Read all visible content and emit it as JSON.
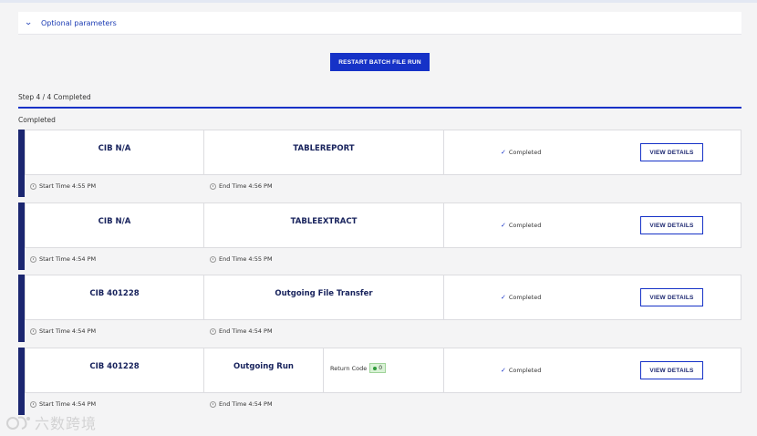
{
  "optional": {
    "label": "Optional parameters"
  },
  "actions": {
    "restart_label": "RESTART BATCH FILE RUN"
  },
  "progress": {
    "steps_label": "Step 4 / 4 Completed",
    "fraction": 1.0
  },
  "section": {
    "title": "Completed"
  },
  "cards": [
    {
      "cib": "CIB N/A",
      "name": "TABLEREPORT",
      "status": "Completed",
      "view_label": "VIEW DETAILS",
      "start": "Start Time 4:55 PM",
      "end": "End Time 4:56 PM"
    },
    {
      "cib": "CIB N/A",
      "name": "TABLEEXTRACT",
      "status": "Completed",
      "view_label": "VIEW DETAILS",
      "start": "Start Time 4:54 PM",
      "end": "End Time 4:55 PM"
    },
    {
      "cib": "CIB 401228",
      "name": "Outgoing File Transfer",
      "status": "Completed",
      "view_label": "VIEW DETAILS",
      "start": "Start Time 4:54 PM",
      "end": "End Time 4:54 PM"
    },
    {
      "cib": "CIB 401228",
      "name": "Outgoing Run",
      "return_code_label": "Return Code",
      "return_code": "0",
      "status": "Completed",
      "view_label": "VIEW DETAILS",
      "start": "Start Time 4:54 PM",
      "end": "End Time 4:54 PM"
    }
  ],
  "watermark": {
    "text": "六数跨境"
  },
  "colors": {
    "accent": "#1632c7",
    "card_bar": "#1b2670",
    "badge_bg": "#d9f2d6"
  }
}
